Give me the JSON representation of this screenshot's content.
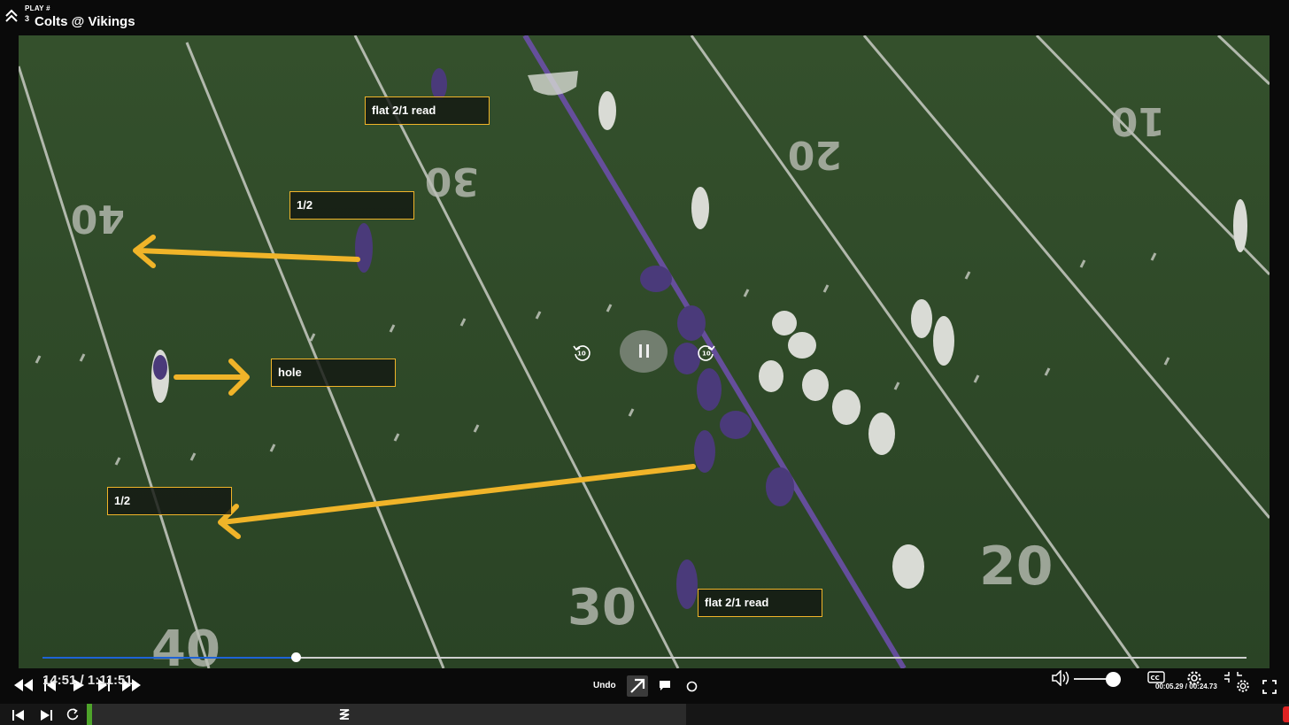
{
  "header": {
    "play_label": "PLAY #",
    "play_number": "3",
    "title": "Colts @ Vikings"
  },
  "annotations": [
    {
      "text": "flat 2/1 read"
    },
    {
      "text": "1/2"
    },
    {
      "text": "hole"
    },
    {
      "text": "1/2"
    },
    {
      "text": "flat 2/1 read"
    }
  ],
  "yard_markers": [
    "40",
    "30",
    "20",
    "10",
    "30",
    "20",
    "40"
  ],
  "player_controls": {
    "rewind_label": "10",
    "forward_label": "10",
    "state": "playing"
  },
  "scrubber": {
    "progress": 0.21
  },
  "controls": {
    "time_display": "14:51 / 1:11:51",
    "undo_label": "Undo",
    "volume": 0.85,
    "cc_label": "CC",
    "clip_time": "00:05.29 / 00:24.73"
  },
  "colors": {
    "annotation": "#f0b429",
    "scrubber_fill": "#1e63d6",
    "timeline_marker": "#4ea42a",
    "field": "#2f4a2a"
  },
  "icons": {
    "collapse": "chevron-up-double-icon",
    "arrow_tool": "arrow-up-right-icon",
    "comment_tool": "speech-bubble-icon",
    "circle_tool": "circle-icon",
    "volume": "speaker-icon",
    "settings": "gear-icon",
    "fullscreen": "expand-icon"
  }
}
